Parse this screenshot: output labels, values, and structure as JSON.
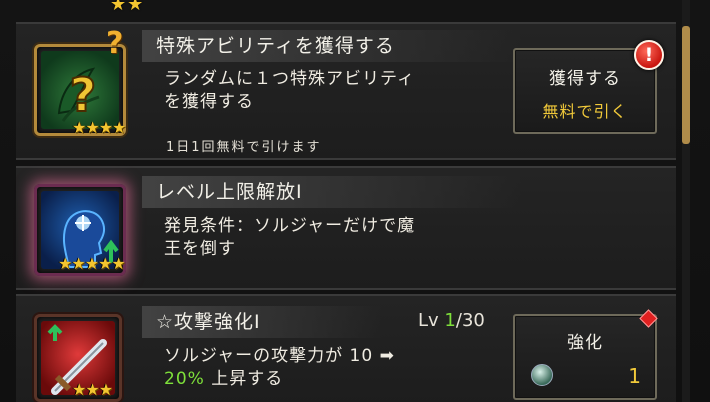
{
  "top_stars": "★★",
  "items": [
    {
      "title": "特殊アビリティを獲得する",
      "desc_line1": "ランダムに１つ特殊アビリティ",
      "desc_line2": "を獲得する",
      "note": "1日1回無料で引けます",
      "stars": "★★★★",
      "button": {
        "line1": "獲得する",
        "line2": "無料で引く"
      },
      "badge": "!"
    },
    {
      "title": "レベル上限解放Ⅰ",
      "desc_line1": "発見条件：ソルジャーだけで魔",
      "desc_line2": "王を倒す",
      "stars": "★★★★★"
    },
    {
      "title": "☆攻撃強化Ⅰ",
      "level_label": "Lv",
      "level_current": "1",
      "level_max": "/30",
      "desc_line1": "ソルジャーの攻撃力が 10 ➡",
      "desc_pct": "20%",
      "desc_line2_rest": " 上昇する",
      "stars": "★★★",
      "button": {
        "line1": "強化",
        "cost": "1"
      }
    }
  ],
  "colors": {
    "accent_gold": "#f1c93a",
    "accent_green": "#7ee03a",
    "badge_red": "#c9160f"
  }
}
